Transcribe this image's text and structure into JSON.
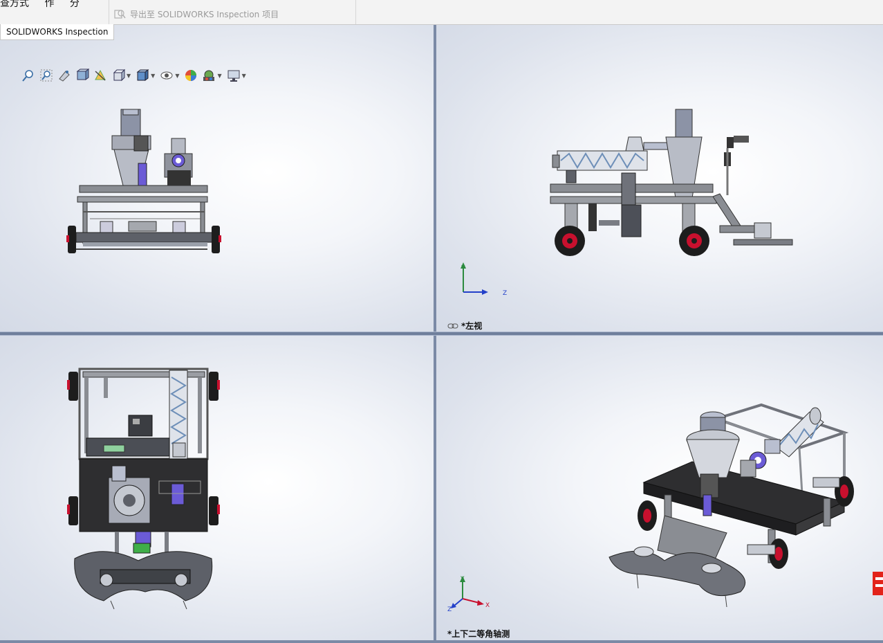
{
  "ribbon": {
    "left_fragment": [
      "查方式",
      "作",
      "分"
    ],
    "export_label": "导出至 SOLIDWORKS Inspection 项目"
  },
  "tabs": {
    "active": "SOLIDWORKS Inspection"
  },
  "hud_toolbar": {
    "icons": [
      "zoom-to-fit-icon",
      "zoom-area-icon",
      "previous-view-icon",
      "section-view-icon",
      "dynamic-annotation-icon",
      "view-orientation-icon",
      "display-style-icon",
      "hide-show-items-icon",
      "edit-appearance-icon",
      "apply-scene-icon",
      "view-settings-icon"
    ]
  },
  "viewports": {
    "front": {
      "label": ""
    },
    "left": {
      "label": "*左视"
    },
    "top": {
      "label": ""
    },
    "iso": {
      "label": "*上下二等角轴测"
    }
  },
  "triad": {
    "x": "X",
    "y": "Y",
    "z": "Z"
  },
  "colors": {
    "viewport_edge": "#d4dae6",
    "splitter": "#7b8aa6",
    "wheel_red": "#c8102e",
    "part_purple": "#6b5bd6",
    "frame_gray": "#8a8d93",
    "plate_dark": "#2e2e30",
    "sw_logo": "#e2231a"
  }
}
